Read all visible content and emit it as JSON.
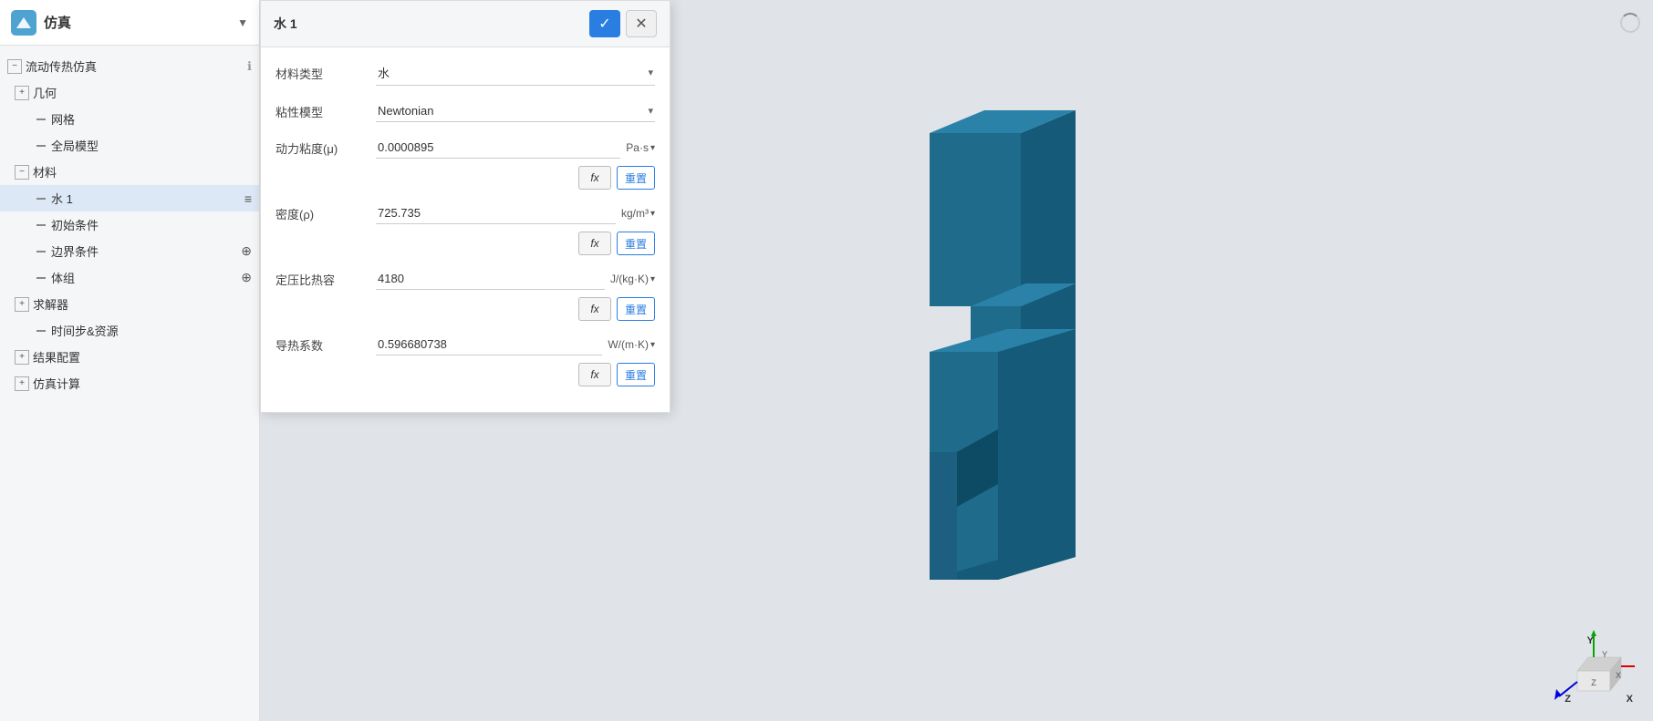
{
  "sidebar": {
    "title": "仿真",
    "chevron": "▼",
    "tree": [
      {
        "id": "flow-heat",
        "label": "流动传热仿真",
        "indent": 0,
        "type": "expand-minus",
        "hasInfo": true
      },
      {
        "id": "geometry",
        "label": "几何",
        "indent": 1,
        "type": "expand-plus"
      },
      {
        "id": "mesh",
        "label": "网格",
        "indent": 2,
        "type": "dash"
      },
      {
        "id": "global-model",
        "label": "全局模型",
        "indent": 2,
        "type": "dash"
      },
      {
        "id": "materials",
        "label": "材料",
        "indent": 1,
        "type": "expand-minus"
      },
      {
        "id": "water1",
        "label": "水 1",
        "indent": 2,
        "type": "dash-selected",
        "selected": true,
        "hasMenu": true
      },
      {
        "id": "initial-conditions",
        "label": "初始条件",
        "indent": 2,
        "type": "dash"
      },
      {
        "id": "boundary-conditions",
        "label": "边界条件",
        "indent": 2,
        "type": "dash",
        "hasAdd": true
      },
      {
        "id": "volume-group",
        "label": "体组",
        "indent": 2,
        "type": "dash",
        "hasAdd": true
      },
      {
        "id": "solver",
        "label": "求解器",
        "indent": 1,
        "type": "expand-plus"
      },
      {
        "id": "time-resources",
        "label": "时间步&资源",
        "indent": 2,
        "type": "dash"
      },
      {
        "id": "result-config",
        "label": "结果配置",
        "indent": 1,
        "type": "expand-plus"
      },
      {
        "id": "simulation-calc",
        "label": "仿真计算",
        "indent": 1,
        "type": "expand-plus"
      }
    ]
  },
  "modal": {
    "title": "水 1",
    "confirmBtn": "✓",
    "closeBtn": "✕",
    "fields": [
      {
        "id": "material-type",
        "label": "材料类型",
        "value": "水",
        "type": "select"
      },
      {
        "id": "viscosity-model",
        "label": "粘性模型",
        "value": "Newtonian",
        "type": "select"
      },
      {
        "id": "dynamic-viscosity",
        "label": "动力粘度(μ)",
        "value": "0.0000895",
        "unit": "Pa·s",
        "type": "input-unit",
        "hasFx": true,
        "hasReset": true,
        "resetLabel": "重置"
      },
      {
        "id": "density",
        "label": "密度(ρ)",
        "value": "725.735",
        "unit": "kg/m³",
        "type": "input-unit",
        "hasFx": true,
        "hasReset": true,
        "resetLabel": "重置"
      },
      {
        "id": "specific-heat",
        "label": "定压比热容",
        "value": "4180",
        "unit": "J/(kg·K)",
        "type": "input-unit",
        "hasFx": true,
        "hasReset": true,
        "resetLabel": "重置"
      },
      {
        "id": "thermal-conductivity",
        "label": "导热系数",
        "value": "0.596680738",
        "unit": "W/(m·K)",
        "type": "input-unit",
        "hasFx": true,
        "hasReset": true,
        "resetLabel": "重置"
      }
    ],
    "fx_label": "fx",
    "reset_label": "重置"
  },
  "viewport": {
    "model_color": "#1e6b8c",
    "model_color_dark": "#155a78",
    "model_color_light": "#2a82a8"
  },
  "axes": {
    "y": "Y",
    "z": "Z",
    "x": "X"
  }
}
